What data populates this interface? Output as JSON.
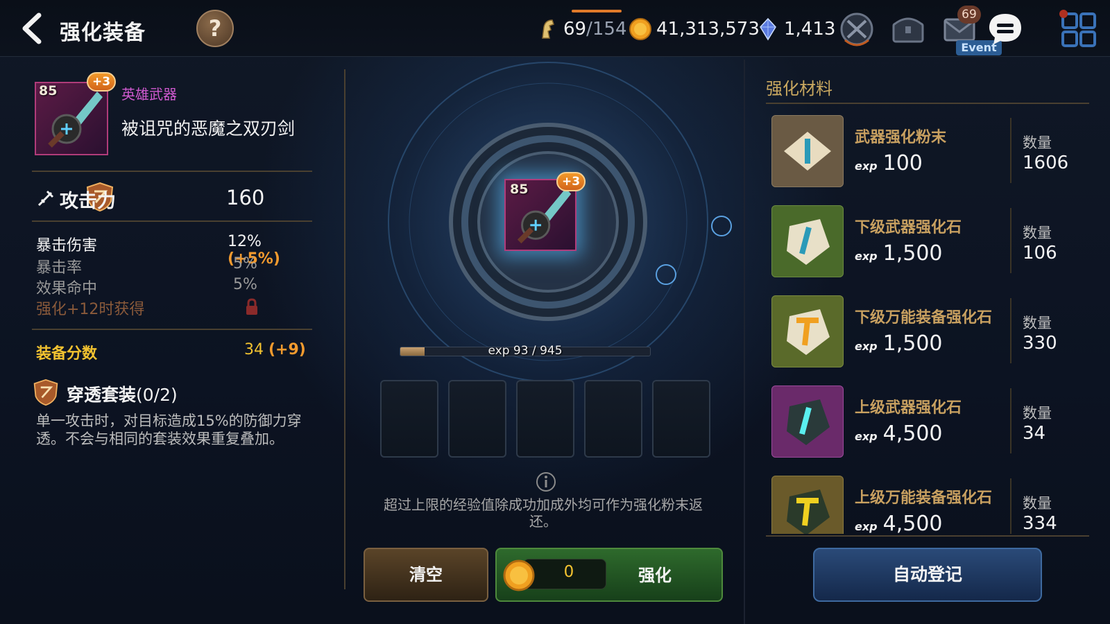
{
  "header": {
    "title": "强化装备",
    "help_label": "?",
    "stamina": {
      "current": "69",
      "max": "/154"
    },
    "gold": "41,313,573",
    "crystals": "1,413",
    "mail_badge": "69",
    "event_label": "Event",
    "icons": [
      "back-arrow-icon",
      "horse-head-icon",
      "gold-coin-icon",
      "crystal-icon",
      "swords-emblem-icon",
      "chest-icon",
      "mail-icon",
      "chat-icon",
      "grid-menu-icon"
    ]
  },
  "item": {
    "level": "85",
    "plus": "+3",
    "rarity": "英雄武器",
    "name": "被诅咒的恶魔之双刃剑",
    "main_stat": {
      "label": "攻击力",
      "value": "160"
    },
    "sub_stats": [
      {
        "label": "暴击伤害",
        "value": "12%",
        "bonus": "(+5%)",
        "color": "#f4f4f4"
      },
      {
        "label": "暴击率",
        "value": "5%",
        "bonus": "",
        "color": "#9a9a9a"
      },
      {
        "label": "效果命中",
        "value": "5%",
        "bonus": "",
        "color": "#9a9a9a"
      },
      {
        "label": "强化+12时获得",
        "value": "",
        "bonus": "",
        "color": "#8a5a3a"
      }
    ],
    "score": {
      "label": "装备分数",
      "value": "34",
      "bonus": "(+9)"
    },
    "set": {
      "name": "穿透套装",
      "count": "(0/2)",
      "desc": "单一攻击时，对目标造成15%的防御力穿透。不会与相同的套装效果重复叠加。"
    }
  },
  "enhance": {
    "exp_text": "exp 93 / 945",
    "exp_current": 93,
    "exp_max": 945,
    "slot_count": 5,
    "notice": "超过上限的经验值除成功加成外均可作为强化粉末返还。",
    "clear_label": "清空",
    "cost": "0",
    "enhance_label": "强化"
  },
  "materials": {
    "title": "强化材料",
    "exp_tag": "exp",
    "qty_label": "数量",
    "items": [
      {
        "name": "武器强化粉末",
        "exp": "100",
        "qty": "1606",
        "color": "#6a5a44",
        "icon": "powder-scroll-icon"
      },
      {
        "name": "下级武器强化石",
        "exp": "1,500",
        "qty": "106",
        "color": "#4a6a2a",
        "icon": "stone-sword-icon"
      },
      {
        "name": "下级万能装备强化石",
        "exp": "1,500",
        "qty": "330",
        "color": "#5a6a2a",
        "icon": "stone-hammer-icon"
      },
      {
        "name": "上级武器强化石",
        "exp": "4,500",
        "qty": "34",
        "color": "#6a2a6a",
        "icon": "dark-stone-sword-icon"
      },
      {
        "name": "上级万能装备强化石",
        "exp": "4,500",
        "qty": "334",
        "color": "#6a5a2a",
        "icon": "dark-stone-hammer-icon"
      }
    ],
    "auto_label": "自动登记"
  }
}
